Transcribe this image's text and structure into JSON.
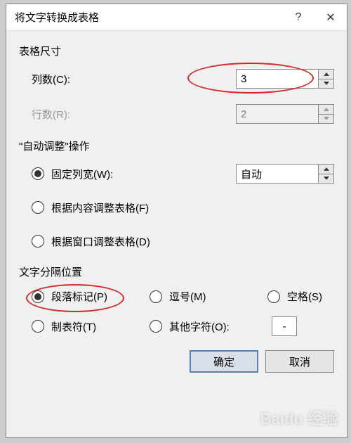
{
  "dialog": {
    "title": "将文字转换成表格",
    "help_symbol": "?",
    "close_symbol": "✕"
  },
  "sections": {
    "size": {
      "label": "表格尺寸",
      "columns": {
        "label": "列数(C):",
        "value": "3"
      },
      "rows": {
        "label": "行数(R):",
        "value": "2"
      }
    },
    "autofit": {
      "label": "\"自动调整\"操作",
      "fixed": {
        "label": "固定列宽(W):",
        "value": "自动"
      },
      "byContent": {
        "label": "根据内容调整表格(F)"
      },
      "byWindow": {
        "label": "根据窗口调整表格(D)"
      }
    },
    "separator": {
      "label": "文字分隔位置",
      "paragraph": {
        "label": "段落标记(P)"
      },
      "comma": {
        "label": "逗号(M)"
      },
      "space": {
        "label": "空格(S)"
      },
      "tab": {
        "label": "制表符(T)"
      },
      "other": {
        "label": "其他字符(O):",
        "value": "-"
      }
    }
  },
  "buttons": {
    "ok": "确定",
    "cancel": "取消"
  },
  "watermark": "Baidu 经验"
}
